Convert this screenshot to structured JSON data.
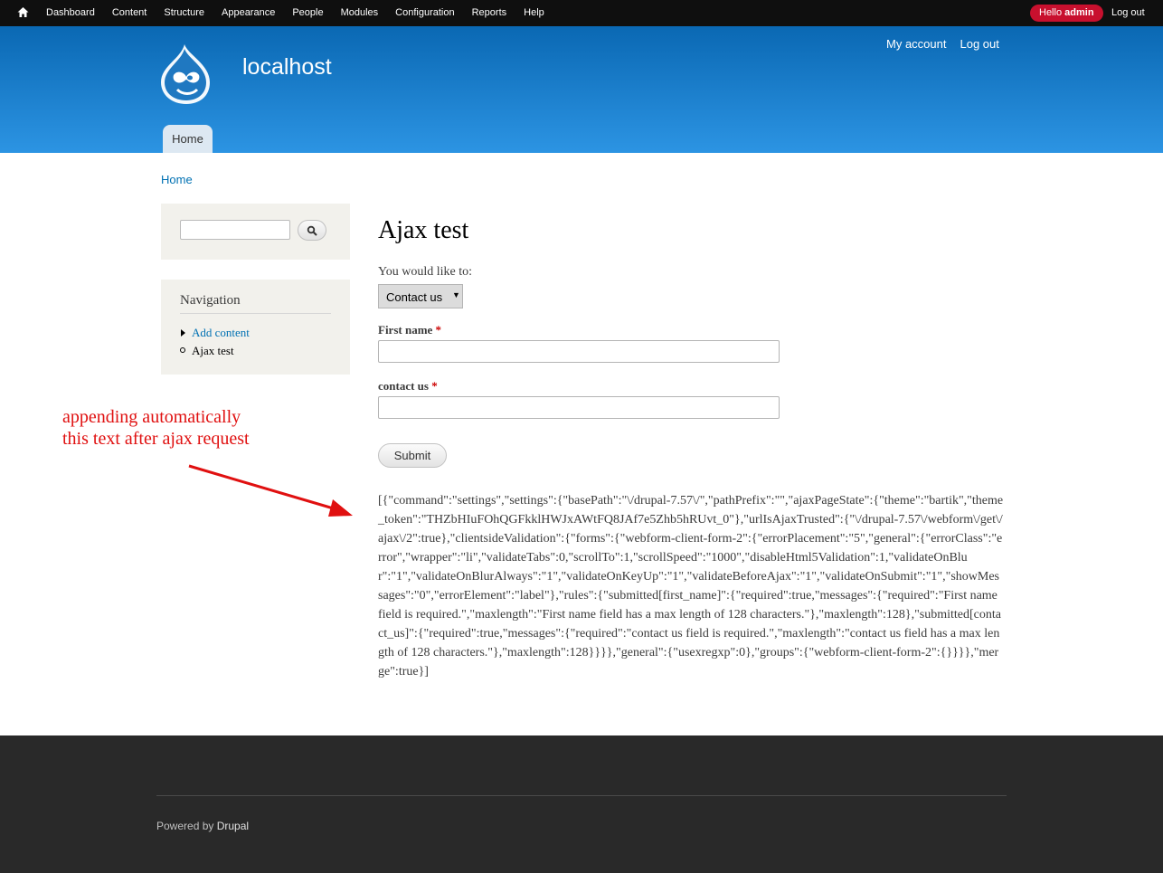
{
  "toolbar": {
    "menu": [
      "Dashboard",
      "Content",
      "Structure",
      "Appearance",
      "People",
      "Modules",
      "Configuration",
      "Reports",
      "Help"
    ],
    "hello_prefix": "Hello",
    "hello_user": "admin",
    "logout": "Log out"
  },
  "header": {
    "site_name": "localhost",
    "secondary_menu": [
      "My account",
      "Log out"
    ],
    "main_tab": "Home"
  },
  "breadcrumb": "Home",
  "sidebar": {
    "navigation_title": "Navigation",
    "items": [
      "Add content",
      "Ajax test"
    ]
  },
  "annotation": {
    "line1": "appending automatically",
    "line2": "this text after ajax request"
  },
  "main": {
    "title": "Ajax test",
    "choice_label": "You would like to:",
    "select_value": "Contact us",
    "first_name_label": "First name",
    "contact_label": "contact us",
    "required_mark": "*",
    "submit": "Submit",
    "ajax_output": "[{\"command\":\"settings\",\"settings\":{\"basePath\":\"\\/drupal-7.57\\/\",\"pathPrefix\":\"\",\"ajaxPageState\":{\"theme\":\"bartik\",\"theme_token\":\"THZbHIuFOhQGFkklHWJxAWtFQ8JAf7e5Zhb5hRUvt_0\"},\"urlIsAjaxTrusted\":{\"\\/drupal-7.57\\/webform\\/get\\/ajax\\/2\":true},\"clientsideValidation\":{\"forms\":{\"webform-client-form-2\":{\"errorPlacement\":\"5\",\"general\":{\"errorClass\":\"error\",\"wrapper\":\"li\",\"validateTabs\":0,\"scrollTo\":1,\"scrollSpeed\":\"1000\",\"disableHtml5Validation\":1,\"validateOnBlur\":\"1\",\"validateOnBlurAlways\":\"1\",\"validateOnKeyUp\":\"1\",\"validateBeforeAjax\":\"1\",\"validateOnSubmit\":\"1\",\"showMessages\":\"0\",\"errorElement\":\"label\"},\"rules\":{\"submitted[first_name]\":{\"required\":true,\"messages\":{\"required\":\"First name field is required.\",\"maxlength\":\"First name field has a max length of 128 characters.\"},\"maxlength\":128},\"submitted[contact_us]\":{\"required\":true,\"messages\":{\"required\":\"contact us field is required.\",\"maxlength\":\"contact us field has a max length of 128 characters.\"},\"maxlength\":128}}}},\"general\":{\"usexregxp\":0},\"groups\":{\"webform-client-form-2\":{}}}},\"merge\":true}]"
  },
  "footer": {
    "powered_by": "Powered by",
    "drupal": "Drupal"
  },
  "colors": {
    "toolbar_bg": "#0f0f0f",
    "header_top": "#0a68b3",
    "header_bottom": "#2c94e3",
    "link": "#0071b3",
    "annotation": "#e01010",
    "hello_badge": "#c8102e",
    "footer_bg": "#292929"
  }
}
